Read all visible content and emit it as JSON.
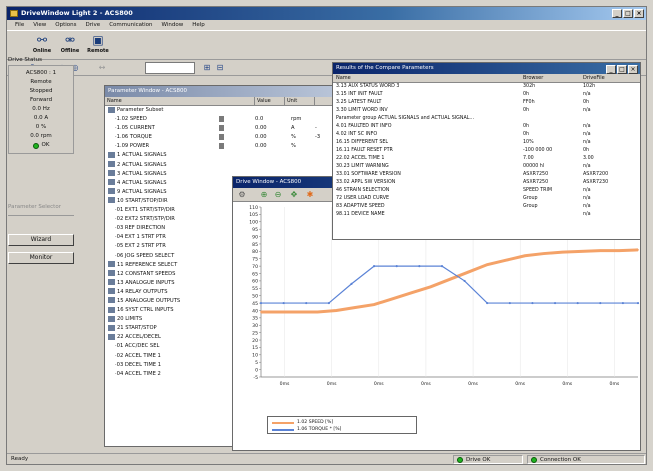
{
  "window": {
    "title": "DriveWindow Light 2 - ACS800"
  },
  "menu": [
    "File",
    "View",
    "Options",
    "Drive",
    "Communication",
    "Window",
    "Help"
  ],
  "toolbar": {
    "tools": [
      {
        "label": "Online",
        "icon": "online-icon"
      },
      {
        "label": "Offline",
        "icon": "offline-icon"
      },
      {
        "label": "Remote",
        "icon": "remote-icon"
      }
    ]
  },
  "drive_status": {
    "title": "Drive Status",
    "lines": [
      "ACS800 : 1",
      "Remote",
      "Stopped",
      "Forward",
      "0.0 Hz",
      "0.0 A",
      "0 %",
      "0.0 rpm"
    ],
    "ok_label": "OK",
    "param_selector": "Parameter Selector",
    "buttons": [
      "Wizard",
      "Monitor"
    ]
  },
  "param_window": {
    "title": "Parameter Window - ACS800",
    "columns": [
      "Name",
      "Value",
      "Unit"
    ],
    "root": "Parameter Subset",
    "rows": [
      {
        "name": "1.02 SPEED",
        "value": "0.0",
        "unit": "rpm",
        "lock": true,
        "extra": ""
      },
      {
        "name": "1.05 CURRENT",
        "value": "0.00",
        "unit": "A",
        "lock": true,
        "extra": "-"
      },
      {
        "name": "1.06 TORQUE",
        "value": "0.00",
        "unit": "%",
        "lock": true,
        "extra": "-3"
      },
      {
        "name": "1.09 POWER",
        "value": "0.00",
        "unit": "%",
        "lock": true,
        "extra": ""
      },
      {
        "name": "1 ACTUAL SIGNALS",
        "group": true
      },
      {
        "name": "2 ACTUAL SIGNALS",
        "group": true
      },
      {
        "name": "3 ACTUAL SIGNALS",
        "group": true
      },
      {
        "name": "4 ACTUAL SIGNALS",
        "group": true
      },
      {
        "name": "9 ACTUAL SIGNALS",
        "group": true
      },
      {
        "name": "10 START/STOP/DIR",
        "group": true
      },
      {
        "name": "01 EXT1 STRT/STP/DIR"
      },
      {
        "name": "02 EXT2 STRT/STP/DIR"
      },
      {
        "name": "03 REF DIRECTION"
      },
      {
        "name": "04 EXT 1 STRT PTR"
      },
      {
        "name": "05 EXT 2 STRT PTR"
      },
      {
        "name": "06 JOG SPEED SELECT"
      },
      {
        "name": "11 REFERENCE SELECT",
        "group": true
      },
      {
        "name": "12 CONSTANT SPEEDS",
        "group": true
      },
      {
        "name": "13 ANALOGUE INPUTS",
        "group": true
      },
      {
        "name": "14 RELAY OUTPUTS",
        "group": true
      },
      {
        "name": "15 ANALOGUE OUTPUTS",
        "group": true
      },
      {
        "name": "16 SYST CTRL INPUTS",
        "group": true
      },
      {
        "name": "20 LIMITS",
        "group": true
      },
      {
        "name": "21 START/STOP",
        "group": true
      },
      {
        "name": "22 ACCEL/DECEL",
        "group": true
      },
      {
        "name": "01 ACC/DEC SEL"
      },
      {
        "name": "02 ACCEL TIME 1"
      },
      {
        "name": "03 DECEL TIME 1"
      },
      {
        "name": "04 ACCEL TIME 2"
      }
    ]
  },
  "drive_window": {
    "title": "Drive Window - ACS800",
    "legend": [
      {
        "name": "1.02 SPEED [%]",
        "color": "#f4a268"
      },
      {
        "name": "1.06 TORQUE * [%]",
        "color": "#5b83d6"
      }
    ]
  },
  "result_window": {
    "title": "Results of the Compare Parameters",
    "columns": [
      "Name",
      "Browser",
      "DriveFile"
    ],
    "rows": [
      {
        "name": "3.13 AUX STATUS WORD 3",
        "browser": "302h",
        "drivefile": "102h"
      },
      {
        "name": "3.15 INT INIT FAULT",
        "browser": "0h",
        "drivefile": "n/a"
      },
      {
        "name": "3.25 LATEST FAULT",
        "browser": "FF0h",
        "drivefile": "0h"
      },
      {
        "name": "3.30 LIMIT WORD INV",
        "browser": "0h",
        "drivefile": "n/a"
      },
      {
        "name": "Parameter group ACTUAL SIGNALS and ACTUAL SIGNAL...",
        "browser": "",
        "drivefile": ""
      },
      {
        "name": "4.01 FAULTED INT INFO",
        "browser": "0h",
        "drivefile": "n/a"
      },
      {
        "name": "4.02 INT SC INFO",
        "browser": "0h",
        "drivefile": "n/a"
      },
      {
        "name": "16.15 DIFFERENT SEL",
        "browser": "10%",
        "drivefile": "n/a"
      },
      {
        "name": "16.11 FAULT RESET PTR",
        "browser": "-100 000 00",
        "drivefile": "0h"
      },
      {
        "name": "22.02 ACCEL TIME 1",
        "browser": "7.00",
        "drivefile": "3.00"
      },
      {
        "name": "30.23 LIMIT WARNING",
        "browser": "00000 hl",
        "drivefile": "n/a"
      },
      {
        "name": "33.01 SOFTWARE VERSION",
        "browser": "ASXR7250",
        "drivefile": "ASXR7200"
      },
      {
        "name": "33.02 APPL SW VERSION",
        "browser": "ASXR7250",
        "drivefile": "ASXR7230"
      },
      {
        "name": "46 STRAIN SELECTION",
        "browser": "SPEED TRIM",
        "drivefile": "n/a"
      },
      {
        "name": "72 USER LOAD CURVE",
        "browser": "Group",
        "drivefile": "n/a"
      },
      {
        "name": "83 ADAPTIVE SPEED",
        "browser": "Group",
        "drivefile": "n/a"
      },
      {
        "name": "98.11 DEVICE NAME",
        "browser": "",
        "drivefile": "n/a"
      }
    ]
  },
  "chart_data": {
    "type": "line",
    "yticks": [
      110,
      105,
      100,
      95,
      90,
      85,
      80,
      75,
      70,
      65,
      60,
      55,
      50,
      45,
      40,
      35,
      30,
      25,
      20,
      15,
      10,
      5,
      0,
      -5
    ],
    "xticks": [
      "0ms",
      "0ms",
      "0ms",
      "0ms",
      "0ms",
      "0ms",
      "0ms",
      "0ms"
    ],
    "ylim": [
      -5,
      110
    ],
    "xlim": [
      0,
      100
    ],
    "series": [
      {
        "name": "1.02 SPEED [%]",
        "color": "#f4a268",
        "x": [
          0,
          5,
          10,
          15,
          20,
          25,
          30,
          35,
          40,
          45,
          50,
          55,
          60,
          65,
          70,
          75,
          80,
          85,
          90,
          95,
          100
        ],
        "y": [
          39,
          39,
          39,
          39,
          40,
          42,
          44,
          48,
          52,
          56,
          61,
          66,
          71,
          74,
          77,
          78.5,
          79.5,
          80,
          80.5,
          80.5,
          81
        ]
      },
      {
        "name": "1.06 TORQUE * [%]",
        "color": "#5b83d6",
        "x": [
          0,
          6,
          12,
          18,
          24,
          30,
          36,
          42,
          48,
          54,
          60,
          66,
          72,
          78,
          84,
          90,
          96,
          100
        ],
        "y": [
          45,
          45,
          45,
          45,
          58,
          70,
          70,
          70,
          70,
          60,
          45,
          45,
          45,
          45,
          45,
          45,
          45,
          45
        ]
      }
    ]
  },
  "status_bar": {
    "left": "Ready",
    "drive": "Drive OK",
    "connection": "Connection OK"
  }
}
